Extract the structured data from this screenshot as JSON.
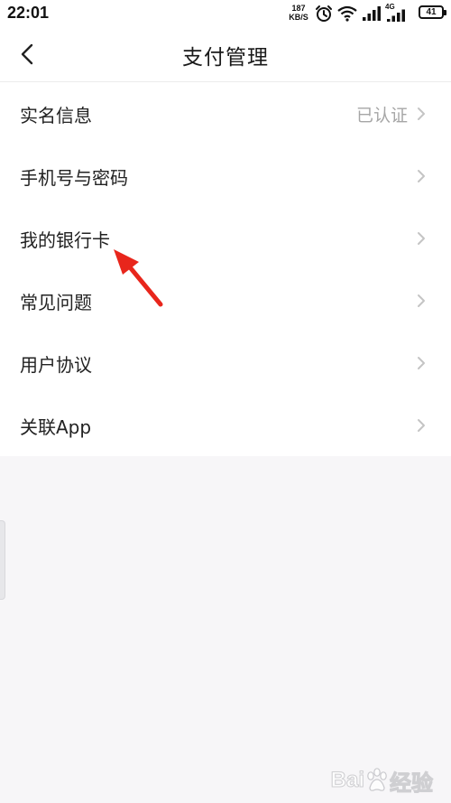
{
  "status_bar": {
    "time": "22:01",
    "net_speed_value": "187",
    "net_speed_unit": "KB/S",
    "network_type": "4G",
    "battery": "41",
    "icons": [
      "alarm-icon",
      "wifi-icon",
      "signal-icon",
      "signal-icon",
      "battery-icon"
    ]
  },
  "header": {
    "title": "支付管理",
    "back_icon": "chevron-left-icon"
  },
  "menu": {
    "items": [
      {
        "label": "实名信息",
        "value": "已认证"
      },
      {
        "label": "手机号与密码",
        "value": ""
      },
      {
        "label": "我的银行卡",
        "value": ""
      },
      {
        "label": "常见问题",
        "value": ""
      },
      {
        "label": "用户协议",
        "value": ""
      },
      {
        "label": "关联App",
        "value": ""
      }
    ]
  },
  "annotation": {
    "color": "#e8261c",
    "points_to": "我的银行卡"
  },
  "watermark": {
    "brand_left": "Bai",
    "brand_right": "经验"
  },
  "colors": {
    "background": "#f7f6f8",
    "surface": "#ffffff",
    "text": "#222222",
    "muted": "#a6a6a6",
    "chevron": "#c4c4c4"
  }
}
